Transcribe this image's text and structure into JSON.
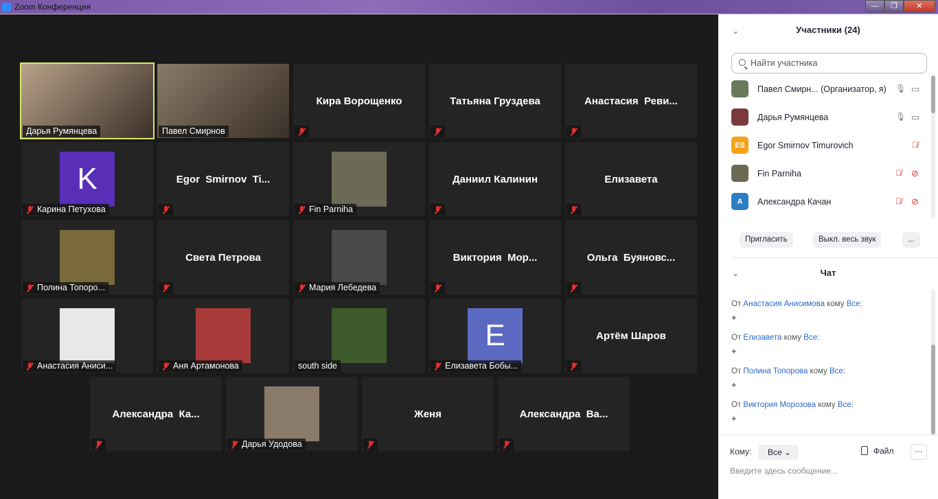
{
  "window": {
    "title": "Zoom Конференция"
  },
  "tiles": [
    {
      "name": "Дарья Румянцева",
      "kind": "video",
      "muted": false,
      "active": true,
      "color": "#b9a28a"
    },
    {
      "name": "Павел Смирнов",
      "kind": "video",
      "muted": false,
      "color": "#8a7a68"
    },
    {
      "name": "Кира Ворощенко",
      "kind": "name",
      "muted": true
    },
    {
      "name": "Татьяна Груздева",
      "kind": "name",
      "muted": true
    },
    {
      "name": "Анастасия  Реви...",
      "kind": "name",
      "muted": true
    },
    {
      "name": "Карина Петухова",
      "kind": "letter",
      "letter": "K",
      "color": "#5a2fb8",
      "muted": true
    },
    {
      "name": "Egor  Smirnov  Ti...",
      "kind": "name",
      "muted": true
    },
    {
      "name": "Fin Parniha",
      "kind": "photo",
      "color": "#6b6a55",
      "muted": true
    },
    {
      "name": "Даниил Калинин",
      "kind": "name",
      "muted": true
    },
    {
      "name": "Елизавета",
      "kind": "name",
      "muted": true
    },
    {
      "name": "Полина Топоро...",
      "kind": "photo",
      "color": "#7a6a3a",
      "muted": true
    },
    {
      "name": "Света Петрова",
      "kind": "name",
      "muted": true
    },
    {
      "name": "Мария Лебедева",
      "kind": "photo",
      "color": "#4a4848",
      "muted": true
    },
    {
      "name": "Виктория  Мор...",
      "kind": "name",
      "muted": true
    },
    {
      "name": "Ольга  Буяновс...",
      "kind": "name",
      "muted": true
    },
    {
      "name": "Анастасия Аниси...",
      "kind": "photo",
      "color": "#e8e8e8",
      "muted": true
    },
    {
      "name": "Аня Артамонова",
      "kind": "photo",
      "color": "#a83a3a",
      "muted": true
    },
    {
      "name": "south side",
      "kind": "photo",
      "color": "#3c5a2a",
      "muted": false
    },
    {
      "name": "Елизавета Бобы...",
      "kind": "letter",
      "letter": "E",
      "color": "#5b6ac0",
      "muted": true
    },
    {
      "name": "Артём Шаров",
      "kind": "name",
      "muted": true
    },
    {
      "name": "Александра  Ка...",
      "kind": "name",
      "muted": true
    },
    {
      "name": "Дарья Удодова",
      "kind": "photo",
      "color": "#8a7a6a",
      "muted": true
    },
    {
      "name": "Женя",
      "kind": "name",
      "muted": true
    },
    {
      "name": "Александра  Ва...",
      "kind": "name",
      "muted": true
    }
  ],
  "participants": {
    "title": "Участники (24)",
    "search_placeholder": "Найти участника",
    "items": [
      {
        "name": "Павел Смирн...  (Организатор, я)",
        "avatar": "",
        "color": "#6a7a5a",
        "mic": "on",
        "video": "on"
      },
      {
        "name": "Дарья Румянцева",
        "avatar": "",
        "color": "#7a3a3a",
        "mic": "on",
        "video": "on"
      },
      {
        "name": "Egor Smirnov Timurovich",
        "avatar": "ES",
        "color": "#f5a21b",
        "mic": "off",
        "video": ""
      },
      {
        "name": "Fin Parniha",
        "avatar": "",
        "color": "#6b6a55",
        "mic": "off",
        "video": "off"
      },
      {
        "name": "Александра Качан",
        "avatar": "A",
        "color": "#2d7fc1",
        "mic": "off",
        "video": "off"
      }
    ],
    "invite": "Пригласить",
    "mute_all": "Выкл. весь звук",
    "more": "..."
  },
  "chat": {
    "title": "Чат",
    "from": "От",
    "to": "кому",
    "messages": [
      {
        "sender": "Анастасия Анисимова",
        "recipient": "Все:",
        "text": "+"
      },
      {
        "sender": "Елизавета",
        "recipient": "Все:",
        "text": "+"
      },
      {
        "sender": "Полина Топорова",
        "recipient": "Все:",
        "text": "+"
      },
      {
        "sender": "Виктория Морозова",
        "recipient": "Все:",
        "text": "+"
      }
    ],
    "to_label": "Кому:",
    "to_value": "Все",
    "file": "Файл",
    "more": "···",
    "input_placeholder": "Введите здесь сообщение..."
  }
}
